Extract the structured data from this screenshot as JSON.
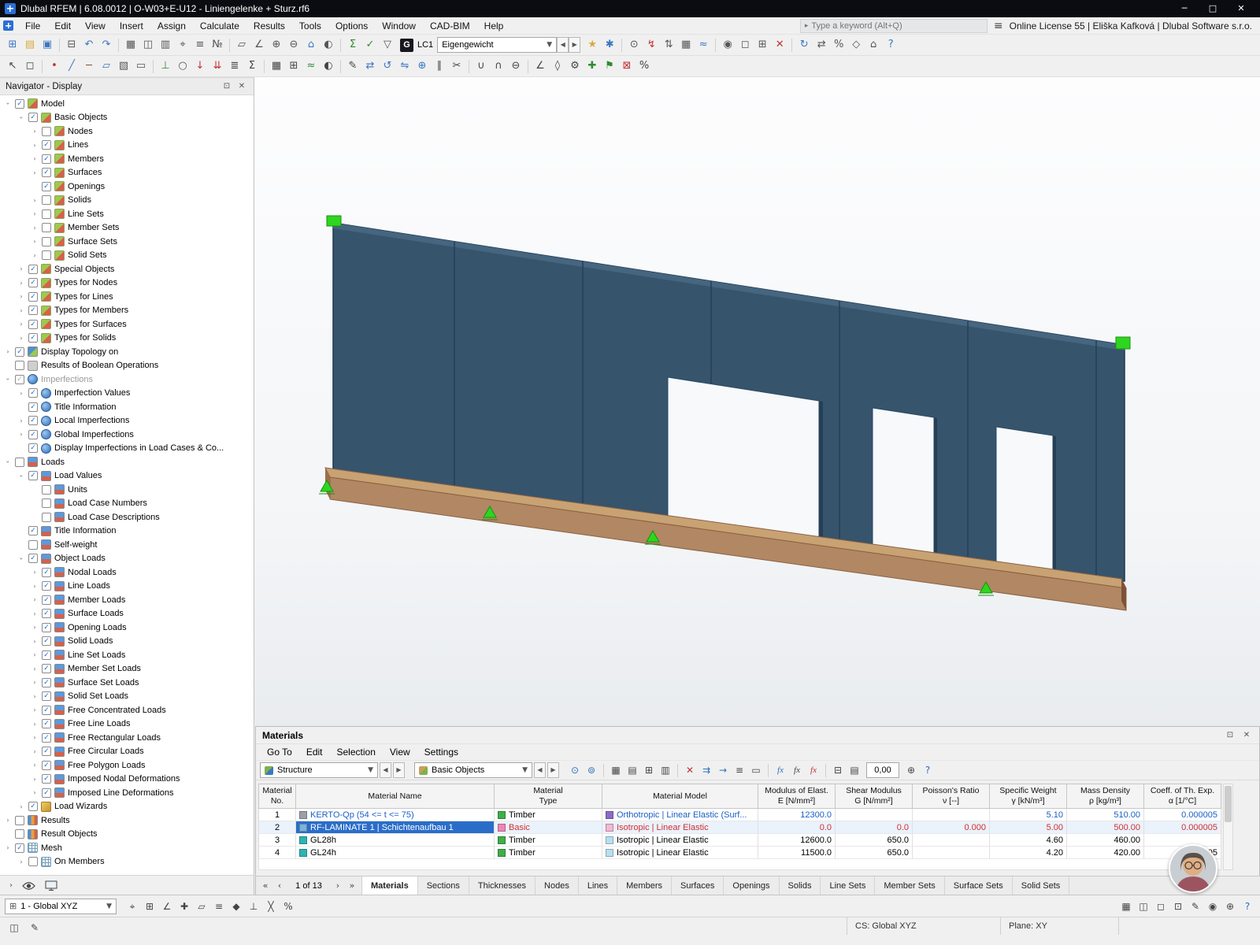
{
  "window": {
    "title": "Dlubal RFEM | 6.08.0012 | O-W03+E-U12 - Liniengelenke + Sturz.rf6",
    "license": "Online License 55 | Eliška Kafková | Dlubal Software s.r.o.",
    "controls": {
      "minimize": "─",
      "maximize": "□",
      "close": "✕"
    }
  },
  "menubar": {
    "items": [
      "File",
      "Edit",
      "View",
      "Insert",
      "Assign",
      "Calculate",
      "Results",
      "Tools",
      "Options",
      "Window",
      "CAD-BIM",
      "Help"
    ],
    "search_placeholder": "Type a keyword (Alt+Q)"
  },
  "toolbar1": {
    "left_icons": [
      [
        "⊞",
        "new-model-icon",
        "#3a76c4"
      ],
      [
        "▤",
        "open-model-icon",
        "#d8a93c"
      ],
      [
        "▣",
        "save-icon",
        "#3a76c4"
      ],
      [
        "|"
      ],
      [
        "⊟",
        "print-icon",
        "#555555"
      ],
      [
        "↶",
        "undo-icon",
        "#3a76c4"
      ],
      [
        "↷",
        "redo-icon",
        "#3a76c4"
      ],
      [
        "|"
      ],
      [
        "▦",
        "tables-icon",
        "#555555"
      ],
      [
        "◫",
        "navigator-icon",
        "#555555"
      ],
      [
        "▥",
        "panels-icon",
        "#555555"
      ],
      [
        "⌖",
        "snap-icon",
        "#555555"
      ],
      [
        "≡",
        "guide-lines-icon",
        "#555555"
      ],
      [
        "№",
        "numbering-icon",
        "#555555"
      ],
      [
        "|"
      ],
      [
        "▱",
        "work-plane-icon",
        "#555555"
      ],
      [
        "∠",
        "angle-icon",
        "#555555"
      ],
      [
        "⊕",
        "zoom-in-icon",
        "#555555"
      ],
      [
        "⊖",
        "zoom-out-icon",
        "#555555"
      ],
      [
        "⌂",
        "home-view-icon",
        "#3a76c4"
      ],
      [
        "◐",
        "render-icon",
        "#555555"
      ],
      [
        "|"
      ],
      [
        "Σ",
        "calculate-icon",
        "#2e8b2e"
      ],
      [
        "✓",
        "check-model-icon",
        "#2e8b2e"
      ],
      [
        "▽",
        "filter-icon",
        "#555555"
      ]
    ],
    "load_case": {
      "badge": "G",
      "label": "LC1",
      "value": "Eigengewicht"
    },
    "right_icons": [
      [
        "★",
        "manage-load-cases-icon",
        "#d8a93c"
      ],
      [
        "✱",
        "load-combinations-icon",
        "#3a76c4"
      ],
      [
        "|"
      ],
      [
        "⊙",
        "show-loads-icon",
        "#555555"
      ],
      [
        "↯",
        "load-values-icon",
        "#c23030"
      ],
      [
        "⇅",
        "sort-icon",
        "#555555"
      ],
      [
        "▦",
        "result-tables-icon",
        "#555555"
      ],
      [
        "≈",
        "show-results-icon",
        "#3a76c4"
      ],
      [
        "|"
      ],
      [
        "◉",
        "visibility-icon",
        "#555555"
      ],
      [
        "◻",
        "selection-box-icon",
        "#555555"
      ],
      [
        "⊞",
        "clipping-planes-icon",
        "#555555"
      ],
      [
        "✕",
        "delete-results-icon",
        "#c23030"
      ],
      [
        "|"
      ],
      [
        "↻",
        "regenerate-icon",
        "#3a76c4"
      ],
      [
        "⇄",
        "swap-icon",
        "#555555"
      ],
      [
        "%",
        "percentage-icon",
        "#555555"
      ],
      [
        "◇",
        "diamond-icon",
        "#555555"
      ],
      [
        "⌂",
        "default-view-icon",
        "#555555"
      ],
      [
        "?",
        "help-icon",
        "#3a76c4"
      ]
    ]
  },
  "toolbar2": {
    "icons": [
      [
        "↖",
        "select-arrow-icon",
        "#444444"
      ],
      [
        "◻",
        "box-select-icon",
        "#444444"
      ],
      [
        "|"
      ],
      [
        "•",
        "insert-node-icon",
        "#c23030"
      ],
      [
        "╱",
        "insert-line-icon",
        "#3a76c4"
      ],
      [
        "─",
        "insert-member-icon",
        "#8a5a2a"
      ],
      [
        "▱",
        "insert-surface-icon",
        "#3a76c4"
      ],
      [
        "▧",
        "insert-solid-icon",
        "#555555"
      ],
      [
        "▭",
        "insert-opening-icon",
        "#555555"
      ],
      [
        "|"
      ],
      [
        "⊥",
        "insert-support-icon",
        "#2e8b2e"
      ],
      [
        "○",
        "insert-hinge-icon",
        "#555555"
      ],
      [
        "↓",
        "insert-nodal-load-icon",
        "#c23030"
      ],
      [
        "⇊",
        "insert-line-load-icon",
        "#c23030"
      ],
      [
        "≣",
        "load-cases-icon",
        "#444444"
      ],
      [
        "Σ",
        "combinations-icon",
        "#444444"
      ],
      [
        "|"
      ],
      [
        "▦",
        "generate-mesh-icon",
        "#444444"
      ],
      [
        "⊞",
        "mesh-settings-icon",
        "#444444"
      ],
      [
        "≈",
        "calculate-all-icon",
        "#2e8b2e"
      ],
      [
        "◐",
        "display-options-icon",
        "#444444"
      ],
      [
        "|"
      ],
      [
        "✎",
        "edit-icon",
        "#444444"
      ],
      [
        "⇄",
        "move-copy-icon",
        "#3a76c4"
      ],
      [
        "↺",
        "rotate-icon",
        "#3a76c4"
      ],
      [
        "⇋",
        "mirror-icon",
        "#3a76c4"
      ],
      [
        "⊕",
        "copy-icon",
        "#3a76c4"
      ],
      [
        "∥",
        "divide-icon",
        "#444444"
      ],
      [
        "✂",
        "trim-icon",
        "#444444"
      ],
      [
        "|"
      ],
      [
        "∪",
        "union-icon",
        "#444444"
      ],
      [
        "∩",
        "intersection-icon",
        "#444444"
      ],
      [
        "⊖",
        "subtract-icon",
        "#444444"
      ],
      [
        "|"
      ],
      [
        "∠",
        "dimensions-icon",
        "#444444"
      ],
      [
        "◊",
        "sections-icon",
        "#444444"
      ],
      [
        "⚙",
        "settings-icon",
        "#444444"
      ],
      [
        "✚",
        "add-objects-icon",
        "#2e8b2e"
      ],
      [
        "⚑",
        "flag-icon",
        "#2e8b2e"
      ],
      [
        "⊠",
        "delete-objects-icon",
        "#c23030"
      ],
      [
        "%",
        "relations-icon",
        "#444444"
      ]
    ]
  },
  "navigator": {
    "title": "Navigator - Display",
    "tree": [
      [
        0,
        "v",
        1,
        "mdl",
        "Model"
      ],
      [
        1,
        "v",
        1,
        "mdl",
        "Basic Objects"
      ],
      [
        2,
        ">",
        0,
        "mdl",
        "Nodes"
      ],
      [
        2,
        ">",
        1,
        "mdl",
        "Lines"
      ],
      [
        2,
        ">",
        1,
        "mdl",
        "Members"
      ],
      [
        2,
        ">",
        1,
        "mdl",
        "Surfaces"
      ],
      [
        2,
        "",
        1,
        "mdl",
        "Openings"
      ],
      [
        2,
        ">",
        0,
        "mdl",
        "Solids"
      ],
      [
        2,
        ">",
        0,
        "mdl",
        "Line Sets"
      ],
      [
        2,
        ">",
        0,
        "mdl",
        "Member Sets"
      ],
      [
        2,
        ">",
        0,
        "mdl",
        "Surface Sets"
      ],
      [
        2,
        ">",
        0,
        "mdl",
        "Solid Sets"
      ],
      [
        1,
        ">",
        1,
        "mdl",
        "Special Objects"
      ],
      [
        1,
        ">",
        1,
        "mdl",
        "Types for Nodes"
      ],
      [
        1,
        ">",
        1,
        "mdl",
        "Types for Lines"
      ],
      [
        1,
        ">",
        1,
        "mdl",
        "Types for Members"
      ],
      [
        1,
        ">",
        1,
        "mdl",
        "Types for Surfaces"
      ],
      [
        1,
        ">",
        1,
        "mdl",
        "Types for Solids"
      ],
      [
        0,
        ">",
        1,
        "topo",
        "Display Topology on"
      ],
      [
        0,
        "",
        0,
        "bool",
        "Results of Boolean Operations"
      ],
      [
        0,
        "v",
        2,
        "imp",
        "Imperfections"
      ],
      [
        1,
        ">",
        1,
        "imp",
        "Imperfection Values"
      ],
      [
        1,
        "",
        1,
        "imp",
        "Title Information"
      ],
      [
        1,
        ">",
        1,
        "imp",
        "Local Imperfections"
      ],
      [
        1,
        ">",
        1,
        "imp",
        "Global Imperfections"
      ],
      [
        1,
        "",
        1,
        "imp",
        "Display Imperfections in Load Cases & Co..."
      ],
      [
        0,
        "v",
        0,
        "lod",
        "Loads"
      ],
      [
        1,
        "v",
        1,
        "lod",
        "Load Values"
      ],
      [
        2,
        "",
        0,
        "lod",
        "Units"
      ],
      [
        2,
        "",
        0,
        "lod",
        "Load Case Numbers"
      ],
      [
        2,
        "",
        0,
        "lod",
        "Load Case Descriptions"
      ],
      [
        1,
        "",
        1,
        "lod",
        "Title Information"
      ],
      [
        1,
        "",
        0,
        "lod",
        "Self-weight"
      ],
      [
        1,
        "v",
        1,
        "lod",
        "Object Loads"
      ],
      [
        2,
        ">",
        1,
        "lod",
        "Nodal Loads"
      ],
      [
        2,
        ">",
        1,
        "lod",
        "Line Loads"
      ],
      [
        2,
        ">",
        1,
        "lod",
        "Member Loads"
      ],
      [
        2,
        ">",
        1,
        "lod",
        "Surface Loads"
      ],
      [
        2,
        ">",
        1,
        "lod",
        "Opening Loads"
      ],
      [
        2,
        ">",
        1,
        "lod",
        "Solid Loads"
      ],
      [
        2,
        ">",
        1,
        "lod",
        "Line Set Loads"
      ],
      [
        2,
        ">",
        1,
        "lod",
        "Member Set Loads"
      ],
      [
        2,
        ">",
        1,
        "lod",
        "Surface Set Loads"
      ],
      [
        2,
        ">",
        1,
        "lod",
        "Solid Set Loads"
      ],
      [
        2,
        ">",
        1,
        "lod",
        "Free Concentrated Loads"
      ],
      [
        2,
        ">",
        1,
        "lod",
        "Free Line Loads"
      ],
      [
        2,
        ">",
        1,
        "lod",
        "Free Rectangular Loads"
      ],
      [
        2,
        ">",
        1,
        "lod",
        "Free Circular Loads"
      ],
      [
        2,
        ">",
        1,
        "lod",
        "Free Polygon Loads"
      ],
      [
        2,
        ">",
        1,
        "lod",
        "Imposed Nodal Deformations"
      ],
      [
        2,
        ">",
        1,
        "lod",
        "Imposed Line Deformations"
      ],
      [
        1,
        ">",
        1,
        "wiz",
        "Load Wizards"
      ],
      [
        0,
        ">",
        0,
        "res",
        "Results"
      ],
      [
        0,
        "",
        0,
        "res",
        "Result Objects"
      ],
      [
        0,
        ">",
        1,
        "msh",
        "Mesh"
      ],
      [
        1,
        ">",
        0,
        "msh",
        "On Members"
      ]
    ]
  },
  "viewport": {
    "wall_color": "#36546c",
    "sill_top_color": "#c9a273",
    "sill_front_color": "#b28763",
    "sill_end_color": "#7d5338",
    "support_color": "#2ed61e",
    "opening_color": "#f7f9fb"
  },
  "materials": {
    "title": "Materials",
    "menu": [
      "Go To",
      "Edit",
      "Selection",
      "View",
      "Settings"
    ],
    "combo1": "Structure",
    "combo2": "Basic Objects",
    "rounding": "0,00",
    "icons_a": [
      [
        "⊙",
        "sync-selection-icon",
        "#2c6fb8"
      ],
      [
        "⊚",
        "select-in-graphic-icon",
        "#2c6fb8"
      ],
      [
        "|"
      ],
      [
        "▦",
        "table-view-icon",
        "#444444"
      ],
      [
        "▤",
        "row-view-icon",
        "#444444"
      ],
      [
        "⊞",
        "insert-row-icon",
        "#444444"
      ],
      [
        "▥",
        "column-filter-icon",
        "#444444"
      ],
      [
        "|"
      ],
      [
        "✕",
        "delete-material-icon",
        "#c23030"
      ],
      [
        "⇉",
        "go-to-row-icon",
        "#2c6fb8"
      ],
      [
        "→",
        "export-table-icon",
        "#2c6fb8"
      ],
      [
        "≡",
        "expand-list-icon",
        "#444444"
      ],
      [
        "▭",
        "select-frame-icon",
        "#444444"
      ],
      [
        "|"
      ],
      [
        "fx",
        "formula-icon",
        "#2c6fb8"
      ],
      [
        "fx",
        "edit-formula-icon",
        "#444444"
      ],
      [
        "fx",
        "remove-formula-icon",
        "#c23030"
      ],
      [
        "|"
      ],
      [
        "⊟",
        "print-table-icon",
        "#444444"
      ],
      [
        "▤",
        "report-icon",
        "#444444"
      ]
    ],
    "icons_b": [
      [
        "⊕",
        "zoom-table-icon",
        "#444444"
      ],
      [
        "?",
        "table-help-icon",
        "#2c6fb8"
      ]
    ],
    "columns": [
      {
        "l1": "Material",
        "l2": "No."
      },
      {
        "l1": "Material Name",
        "l2": ""
      },
      {
        "l1": "Material",
        "l2": "Type"
      },
      {
        "l1": "Material Model",
        "l2": ""
      },
      {
        "l1": "Modulus of Elast.",
        "l2": "E [N/mm²]"
      },
      {
        "l1": "Shear Modulus",
        "l2": "G [N/mm²]"
      },
      {
        "l1": "Poisson's Ratio",
        "l2": "ν [--]"
      },
      {
        "l1": "Specific Weight",
        "l2": "γ [kN/m³]"
      },
      {
        "l1": "Mass Density",
        "l2": "ρ [kg/m³]"
      },
      {
        "l1": "Coeff. of Th. Exp.",
        "l2": "α [1/°C]"
      }
    ],
    "rows": [
      {
        "no": "1",
        "name": "KERTO-Qp (54 <= t <= 75)",
        "name_icon": "#9aa0a6",
        "type": "Timber",
        "type_icon": "#3fae49",
        "model": "Orthotropic | Linear Elastic (Surf...",
        "model_icon": "#8c6bc8",
        "e": "12300.0",
        "g": "",
        "nu": "",
        "gamma": "5.10",
        "rho": "510.00",
        "alpha": "0.000005",
        "fg": "#1a5fc8",
        "type_fg": "#000000",
        "selected": false
      },
      {
        "no": "2",
        "name": "RF-LAMINATE 1 | Schichtenaufbau 1",
        "name_icon": "#7bb3d9",
        "type": "Basic",
        "type_icon": "#ef86b5",
        "model": "Isotropic | Linear Elastic",
        "model_icon": "#f2b8d4",
        "e": "0.0",
        "g": "0.0",
        "nu": "0.000",
        "gamma": "5.00",
        "rho": "500.00",
        "alpha": "0.000005",
        "fg": "#d22f2f",
        "type_fg": "#d22f2f",
        "selected": true
      },
      {
        "no": "3",
        "name": "GL28h",
        "name_icon": "#2fb3b3",
        "type": "Timber",
        "type_icon": "#3fae49",
        "model": "Isotropic | Linear Elastic",
        "model_icon": "#b8dff0",
        "e": "12600.0",
        "g": "650.0",
        "nu": "",
        "gamma": "4.60",
        "rho": "460.00",
        "alpha": "",
        "fg": "#000000",
        "type_fg": "#000000",
        "selected": false
      },
      {
        "no": "4",
        "name": "GL24h",
        "name_icon": "#2fb3b3",
        "type": "Timber",
        "type_icon": "#3fae49",
        "model": "Isotropic | Linear Elastic",
        "model_icon": "#b8dff0",
        "e": "11500.0",
        "g": "650.0",
        "nu": "",
        "gamma": "4.20",
        "rho": "420.00",
        "alpha": "0.000005",
        "fg": "#000000",
        "type_fg": "#000000",
        "selected": false
      }
    ],
    "pagination": {
      "current": "1 of 13"
    },
    "tabs": [
      "Materials",
      "Sections",
      "Thicknesses",
      "Nodes",
      "Lines",
      "Members",
      "Surfaces",
      "Openings",
      "Solids",
      "Line Sets",
      "Member Sets",
      "Surface Sets",
      "Solid Sets"
    ],
    "active_tab": "Materials"
  },
  "statusbar": {
    "cs_combo": "1 - Global XYZ",
    "cs_label": "CS: Global XYZ",
    "plane_label": "Plane: XY",
    "left_icons": [
      [
        "⌖",
        "snap-points-icon",
        "#444444"
      ],
      [
        "⊞",
        "grid-snap-icon",
        "#444444"
      ],
      [
        "∠",
        "ortho-mode-icon",
        "#444444"
      ],
      [
        "✚",
        "crosshair-icon",
        "#444444"
      ],
      [
        "▱",
        "work-plane-status-icon",
        "#444444"
      ],
      [
        "≡",
        "object-snap-icon",
        "#444444"
      ],
      [
        "◆",
        "midpoint-snap-icon",
        "#444444"
      ],
      [
        "⊥",
        "perpendicular-snap-icon",
        "#444444"
      ],
      [
        "╳",
        "intersection-snap-icon",
        "#444444"
      ],
      [
        "%",
        "relative-snap-icon",
        "#444444"
      ]
    ],
    "right_icons": [
      [
        "▦",
        "tables-toggle-icon",
        "#444444"
      ],
      [
        "◫",
        "panels-toggle-icon",
        "#444444"
      ],
      [
        "◻",
        "selection-mode-icon",
        "#444444"
      ],
      [
        "⊡",
        "pick-mode-icon",
        "#444444"
      ],
      [
        "✎",
        "edit-mode-icon",
        "#444444"
      ],
      [
        "◉",
        "view-mode-icon",
        "#444444"
      ],
      [
        "⊕",
        "zoom-status-icon",
        "#444444"
      ],
      [
        "?",
        "status-help-icon",
        "#2c6fb8"
      ]
    ],
    "bottom_icons": [
      [
        "◫",
        "layout-toggle-icon",
        "#444444"
      ],
      [
        "✎",
        "annotation-icon",
        "#444444"
      ]
    ]
  }
}
